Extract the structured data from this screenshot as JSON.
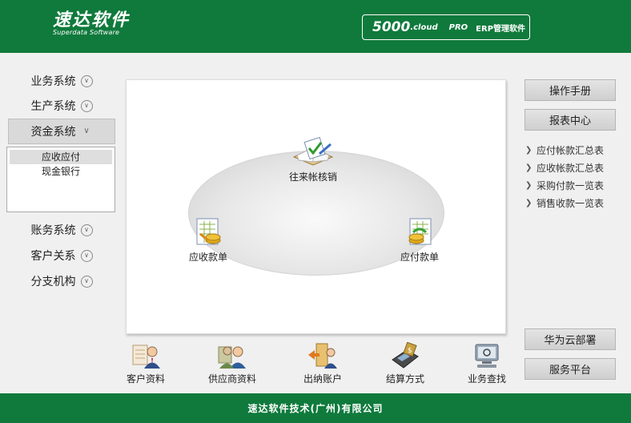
{
  "header": {
    "logo_main": "速达软件",
    "logo_sub": "Superdata Software",
    "product_num": "5000",
    "product_cloud": ".cloud",
    "product_pro": "PRO",
    "product_erp": "ERP管理软件"
  },
  "nav": {
    "items": [
      {
        "label": "业务系统",
        "icon": "chevron-down-circle-icon"
      },
      {
        "label": "生产系统",
        "icon": "chevron-down-circle-icon"
      },
      {
        "label": "资金系统",
        "icon": "chevron-double-down-icon"
      },
      {
        "label": "账务系统",
        "icon": "chevron-down-circle-icon"
      },
      {
        "label": "客户关系",
        "icon": "chevron-down-circle-icon"
      },
      {
        "label": "分支机构",
        "icon": "chevron-down-circle-icon"
      }
    ],
    "submenu": [
      "应收应付",
      "现金银行"
    ]
  },
  "flow": {
    "verify": "往来帐核销",
    "receivable": "应收款单",
    "payable": "应付款单"
  },
  "right": {
    "manual": "操作手册",
    "report_center": "报表中心",
    "reports": [
      "应付帐款汇总表",
      "应收帐款汇总表",
      "采购付款一览表",
      "销售收款一览表"
    ],
    "huawei": "华为云部署",
    "service": "服务平台"
  },
  "shortcuts": [
    "客户资料",
    "供应商资料",
    "出纳账户",
    "结算方式",
    "业务查找"
  ],
  "footer": "速达软件技术(广州)有限公司",
  "colors": {
    "brand_green": "#0f7a3c"
  }
}
